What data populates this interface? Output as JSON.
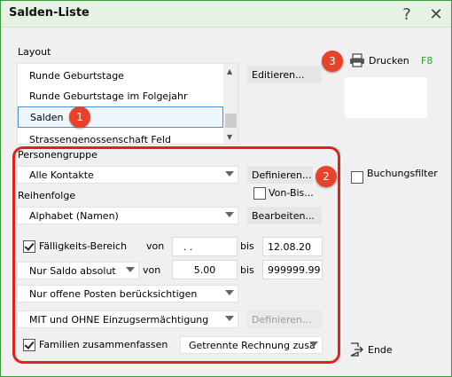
{
  "window": {
    "title": "Salden-Liste",
    "help_glyph": "?",
    "close_glyph": "✕"
  },
  "layout": {
    "label": "Layout",
    "items": [
      {
        "label": "Runde Geburtstage"
      },
      {
        "label": "Runde Geburtstage im Folgejahr"
      },
      {
        "label": "Salden"
      },
      {
        "label": "Strassengenossenschaft Feld"
      }
    ],
    "selected_index": 2,
    "edit_button": "Editieren..."
  },
  "print": {
    "label": "Drucken",
    "shortcut": "F8"
  },
  "booking_filter": {
    "label": "Buchungsfilter",
    "checked": false
  },
  "exit": {
    "label": "Ende"
  },
  "person_group": {
    "label": "Personengruppe",
    "value": "Alle Kontakte",
    "define_button": "Definieren...",
    "from_to_label": "Von-Bis...",
    "from_to_checked": false
  },
  "sort": {
    "label": "Reihenfolge",
    "value": "Alphabet (Namen)",
    "edit_button": "Bearbeiten..."
  },
  "due_range": {
    "label": "Fälligkeits-Bereich",
    "checked": true,
    "von_label": "von",
    "from_value": ". .",
    "bis_label": "bis",
    "to_value": "12.08.20"
  },
  "balance": {
    "mode": "Nur Saldo absolut",
    "von_label": "von",
    "from_value": "5.00",
    "bis_label": "bis",
    "to_value": "999999.99"
  },
  "open_items": {
    "value": "Nur offene Posten berücksichtigen"
  },
  "direct_debit": {
    "value": "MIT und OHNE Einzugsermächtigung",
    "define_button": "Definieren..."
  },
  "families": {
    "label": "Familien zusammenfassen",
    "checked": true,
    "mode": "Getrennte Rechnung zusä"
  },
  "badges": {
    "one": "1",
    "two": "2",
    "three": "3"
  },
  "icons": {
    "help": "help-icon",
    "close": "close-icon",
    "printer": "printer-icon",
    "exit": "exit-icon"
  }
}
